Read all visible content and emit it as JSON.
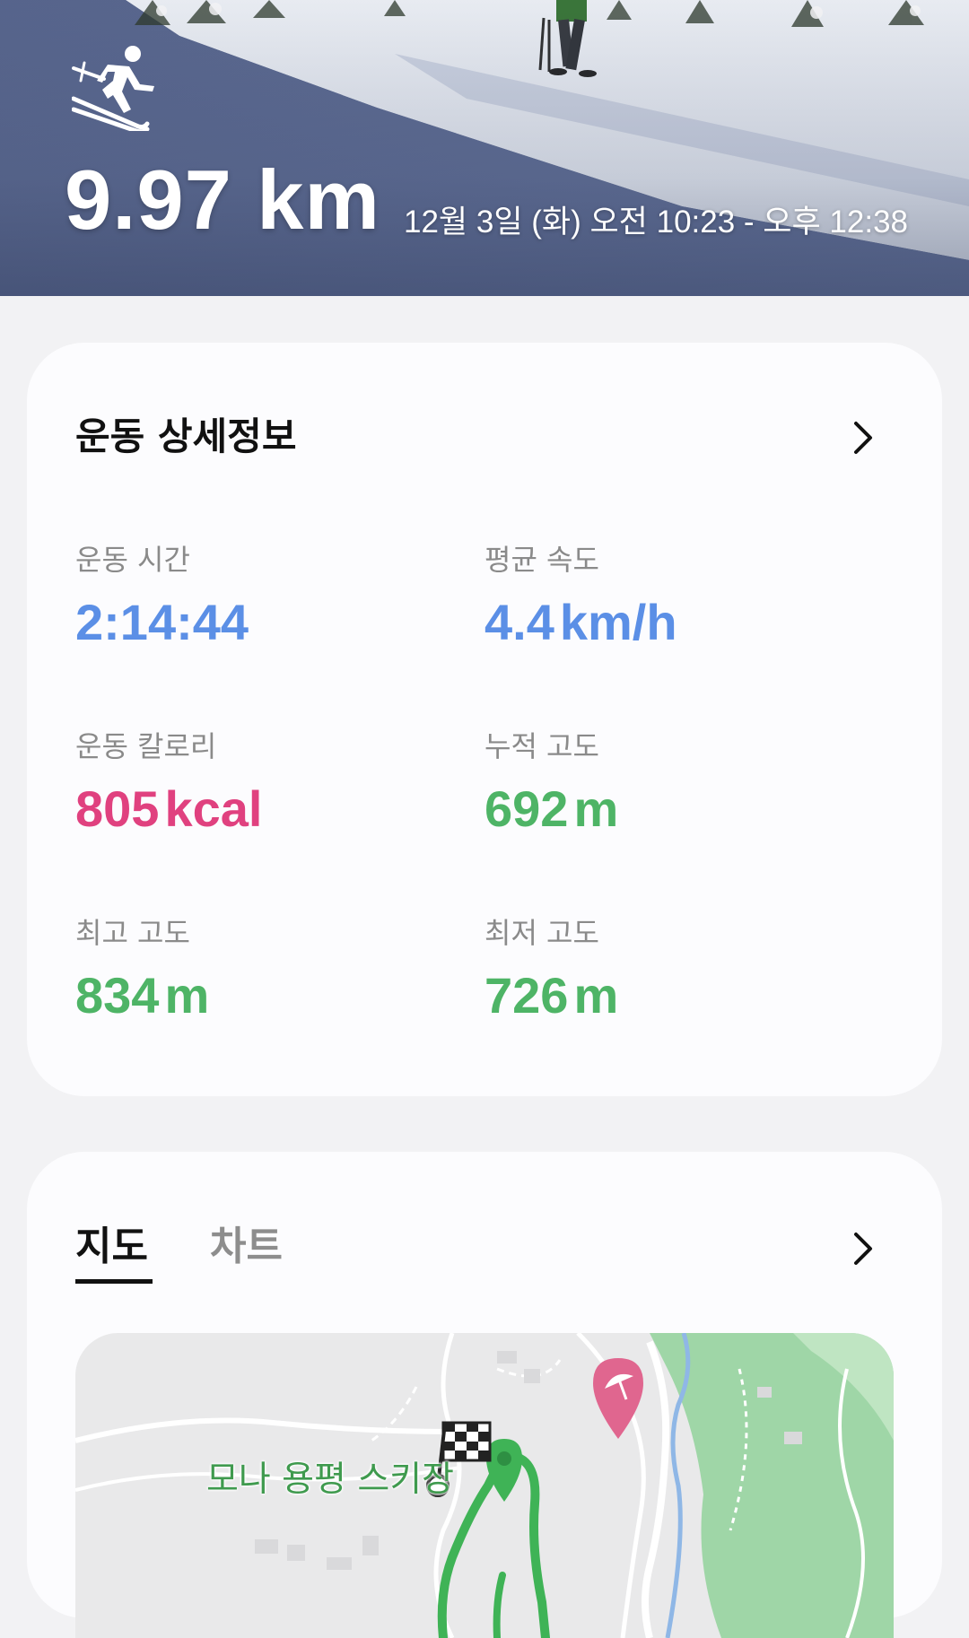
{
  "hero": {
    "activity_icon": "skiing-icon",
    "distance": "9.97 km",
    "date_range": "12월 3일 (화) 오전 10:23 - 오후 12:38"
  },
  "details": {
    "title": "운동 상세정보",
    "more_icon": "chevron-right-icon",
    "stats": [
      {
        "label": "운동 시간",
        "value": "2:14:44",
        "unit": "",
        "color": "#5b8fe6"
      },
      {
        "label": "평균 속도",
        "value": "4.4",
        "unit": "km/h",
        "color": "#5b8fe6"
      },
      {
        "label": "운동 칼로리",
        "value": "805",
        "unit": "kcal",
        "color": "#e0417f"
      },
      {
        "label": "누적 고도",
        "value": "692",
        "unit": "m",
        "color": "#4eb466"
      },
      {
        "label": "최고 고도",
        "value": "834",
        "unit": "m",
        "color": "#4eb466"
      },
      {
        "label": "최저 고도",
        "value": "726",
        "unit": "m",
        "color": "#4eb466"
      }
    ]
  },
  "map_section": {
    "tabs": [
      {
        "label": "지도",
        "selected": true
      },
      {
        "label": "차트",
        "selected": false
      }
    ],
    "more_icon": "chevron-right-icon",
    "place_label": "모나 용평 스키장",
    "markers": [
      "finish-flag-icon",
      "location-pin-icon",
      "beach-umbrella-icon"
    ],
    "route_color": "#3fb356"
  }
}
